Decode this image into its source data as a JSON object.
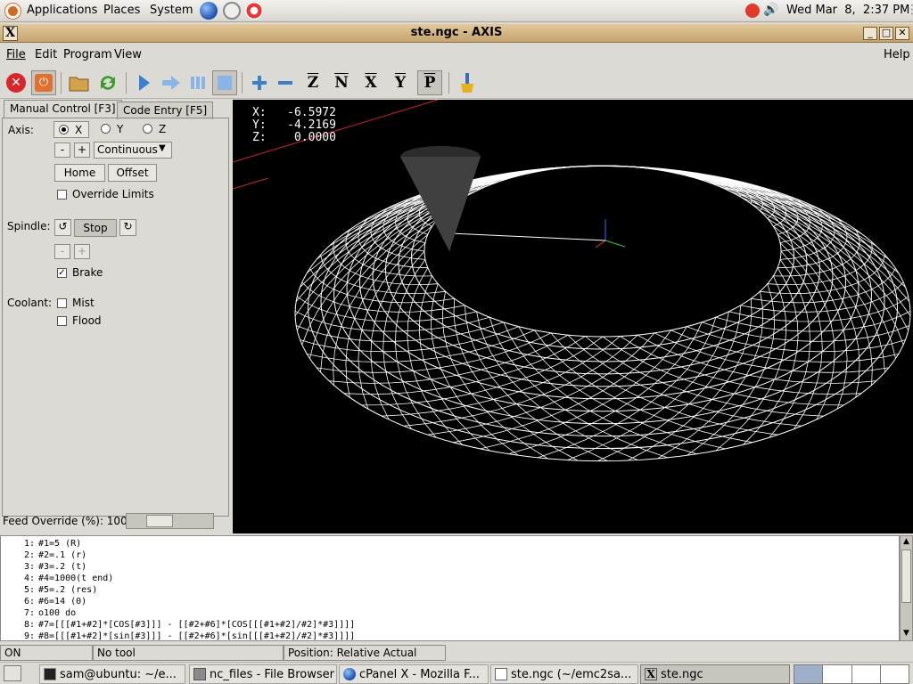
{
  "panel": {
    "menus": [
      "Applications",
      "Places",
      "System"
    ],
    "clock": "Wed Mar  8,  2:37 PM"
  },
  "window": {
    "title": "ste.ngc - AXIS",
    "wm_icon_text": "X",
    "min": "_",
    "max": "□",
    "close": "✕"
  },
  "menubar": {
    "items": [
      "File",
      "Edit",
      "Program",
      "View"
    ],
    "help": "Help"
  },
  "toolbar": {
    "buttons": [
      "estop-icon",
      "machine-power-icon",
      "open-folder-icon",
      "reload-icon",
      "run-icon",
      "step-icon",
      "pause-icon",
      "stop-icon",
      "zoom-in-icon",
      "zoom-out-icon",
      "view-z-icon",
      "view-z2-icon",
      "view-x-icon",
      "view-y-icon",
      "view-p-icon",
      "clear-plot-icon"
    ],
    "view_letters": [
      "Z",
      "N",
      "X",
      "Y",
      "P"
    ]
  },
  "tabs": [
    "Manual Control [F3]",
    "Code Entry [F5]"
  ],
  "manual": {
    "axis_label": "Axis:",
    "axes": [
      "X",
      "Y",
      "Z"
    ],
    "selected_axis": "X",
    "minus": "-",
    "plus": "+",
    "jog_mode": "Continuous",
    "home": "Home",
    "offset": "Offset",
    "override_limits": "Override Limits",
    "spindle_label": "Spindle:",
    "stop": "Stop",
    "brake": "Brake",
    "coolant_label": "Coolant:",
    "mist": "Mist",
    "flood": "Flood"
  },
  "feed_override": {
    "label": "Feed Override (%): 100",
    "value": 100
  },
  "dro": {
    "x": "X:   -6.5972",
    "y": "Y:   -4.2169",
    "z": "Z:    0.0000"
  },
  "code": [
    {
      "n": "1:",
      "t": "#1=5 (R)"
    },
    {
      "n": "2:",
      "t": "#2=.1 (r)"
    },
    {
      "n": "3:",
      "t": "#3=.2 (t)"
    },
    {
      "n": "4:",
      "t": "#4=1000(t end)"
    },
    {
      "n": "5:",
      "t": "#5=.2 (res)"
    },
    {
      "n": "6:",
      "t": "#6=14 (0)"
    },
    {
      "n": "7:",
      "t": "o100 do"
    },
    {
      "n": "8:",
      "t": "#7=[[[#1+#2]*[COS[#3]]] - [[#2+#6]*[COS[[[#1+#2]/#2]*#3]]]]"
    },
    {
      "n": "9:",
      "t": "#8=[[[#1+#2]*[sin[#3]]] - [[#2+#6]*[sin[[[#1+#2]/#2]*#3]]]]"
    }
  ],
  "status": {
    "state": "ON",
    "tool": "No tool",
    "position": "Position: Relative Actual"
  },
  "taskbar": [
    "sam@ubuntu: ~/e...",
    "nc_files - File Browser",
    "cPanel X - Mozilla F...",
    "ste.ngc (~/emc2sa...",
    "ste.ngc"
  ],
  "colors": {
    "titlebar": "#d6b987",
    "estop": "#d9262b",
    "preview_bg": "#000000",
    "toolpath": "#ffffff"
  }
}
